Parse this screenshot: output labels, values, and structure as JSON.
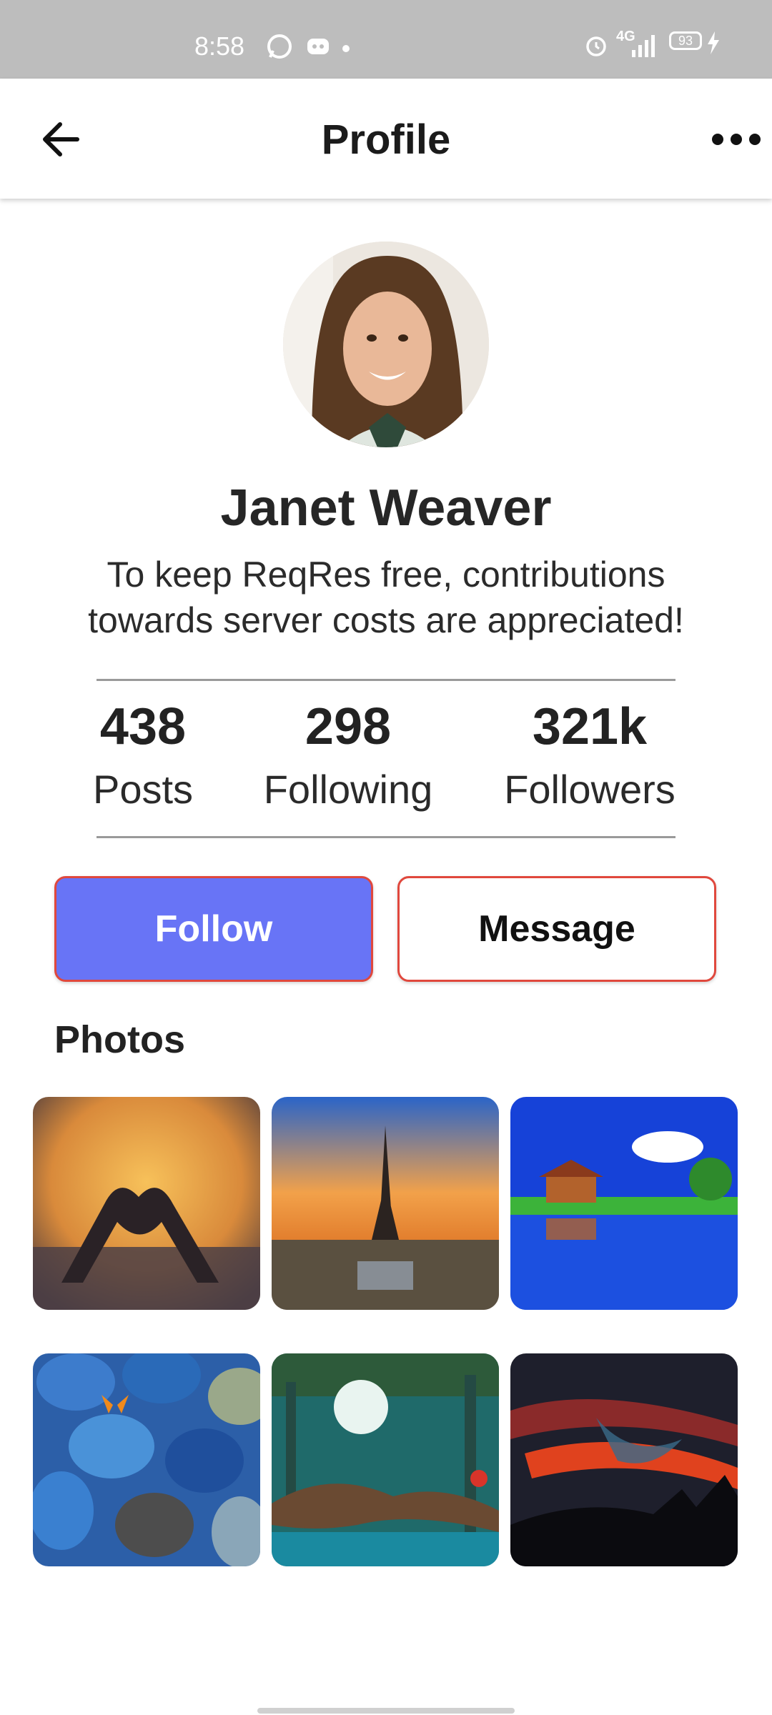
{
  "status_bar": {
    "time": "8:58",
    "network": "4G",
    "battery": "93"
  },
  "app_bar": {
    "title": "Profile"
  },
  "profile": {
    "name": "Janet Weaver",
    "bio_line1": "To keep ReqRes free, contributions",
    "bio_line2": "towards server costs are appreciated!"
  },
  "stats": [
    {
      "value": "438",
      "label": "Posts"
    },
    {
      "value": "298",
      "label": "Following"
    },
    {
      "value": "321k",
      "label": "Followers"
    }
  ],
  "actions": {
    "follow_label": "Follow",
    "message_label": "Message"
  },
  "photos": {
    "heading": "Photos",
    "items": [
      "heart-sunset-photo",
      "eiffel-tower-photo",
      "lake-house-photo",
      "pebbles-butterfly-photo",
      "enchanted-forest-photo",
      "red-sky-sunset-photo"
    ]
  },
  "colors": {
    "accent": "#6874f6",
    "button_border": "#e0483d",
    "status_bar": "#bdbdbd"
  }
}
